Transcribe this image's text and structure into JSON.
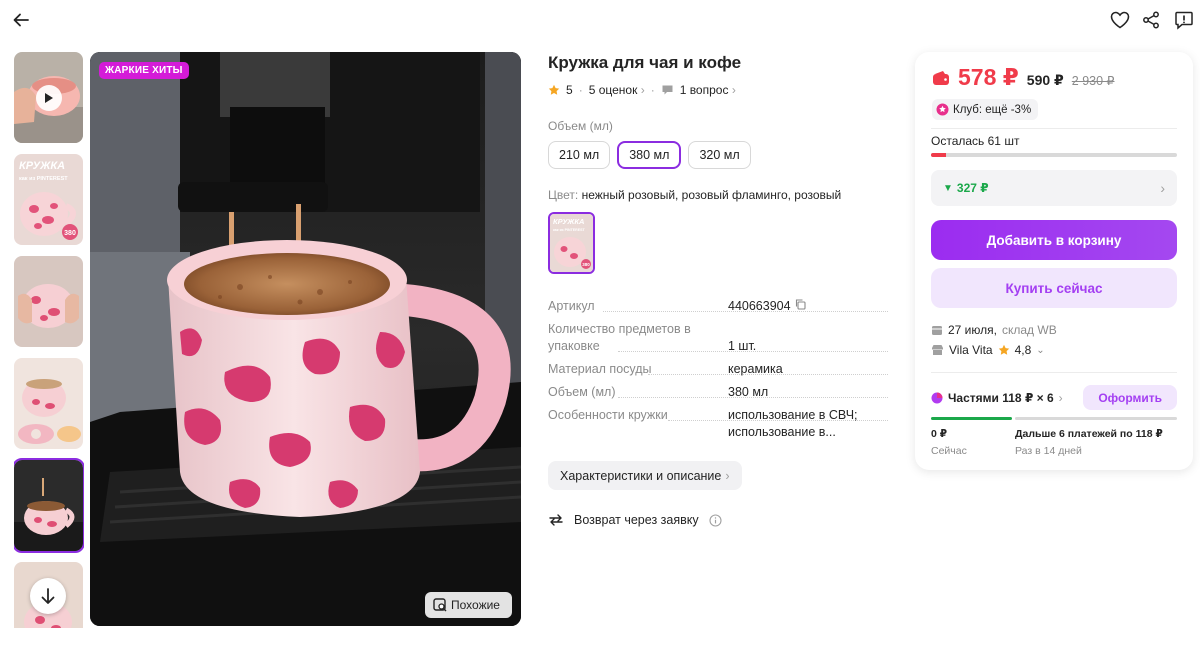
{
  "icons": {
    "back": "arrow-left-icon",
    "favorite": "heart-icon",
    "share": "share-icon",
    "report": "complaint-icon"
  },
  "gallery": {
    "badge": "ЖАРКИЕ ХИТЫ",
    "similar_label": "Похожие",
    "thumbnail_text": {
      "title_line1": "КРУЖКА",
      "title_line2": "как из PINTEREST",
      "volume_badge": "380"
    }
  },
  "product": {
    "title": "Кружка для чая и кофе",
    "rating": "5",
    "reviews": "5 оценок",
    "questions": "1 вопрос",
    "volume_label": "Объем (мл)",
    "sizes": [
      "210 мл",
      "380 мл",
      "320 мл"
    ],
    "selected_size": "380 мл",
    "color_label": "Цвет:",
    "color_value": "нежный розовый, розовый фламинго, розовый",
    "color_thumb_text": {
      "title": "КРУЖКА",
      "subtitle": "как из PINTEREST",
      "volume_badge": "380"
    },
    "specs": [
      {
        "key": "Артикул",
        "value": "440663904"
      },
      {
        "key": "Количество предметов в упаковке",
        "value": "1 шт."
      },
      {
        "key": "Материал посуды",
        "value": "керамика"
      },
      {
        "key": "Объем (мл)",
        "value": "380 мл"
      },
      {
        "key": "Особенности кружки",
        "value": "использование в СВЧ; использование в..."
      }
    ],
    "characteristics_button": "Характеристики и описание",
    "return_text": "Возврат через заявку"
  },
  "buy_card": {
    "price": "578 ₽",
    "price_without_wallet": "590 ₽",
    "old_price": "2 930 ₽",
    "club_text": "Клуб: ещё -3%",
    "stock_text": "Осталась 61 шт",
    "stock_fraction": 0.06,
    "wb_price": "327 ₽",
    "add_to_cart": "Добавить в корзину",
    "buy_now": "Купить сейчас",
    "delivery": "27 июля,",
    "warehouse": "склад WB",
    "seller": "Vila Vita",
    "seller_rating": "4,8",
    "installments": "Частями 118 ₽ × 6",
    "checkout": "Оформить",
    "now_amount": "0 ₽",
    "now_label": "Сейчас",
    "later_amount": "Дальше 6 платежей по 118 ₽",
    "later_label": "Раз в 14 дней"
  },
  "colors": {
    "accent": "#a43ff2",
    "price_red": "#f03b4a",
    "green": "#1ba84a",
    "hot_badge": "#d41bd8"
  }
}
